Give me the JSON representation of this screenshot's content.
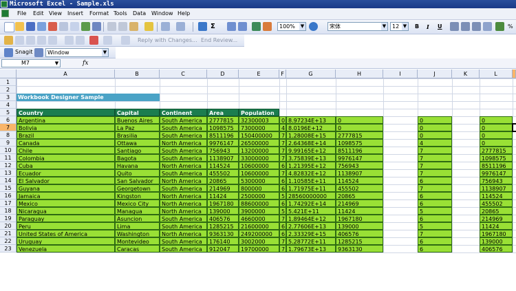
{
  "window": {
    "title": "Microsoft Excel - Sample.xls"
  },
  "menu": [
    "File",
    "Edit",
    "View",
    "Insert",
    "Format",
    "Tools",
    "Data",
    "Window",
    "Help"
  ],
  "toolbar": {
    "zoom": "100%",
    "font": "宋体",
    "font_size": "12",
    "bold": "B",
    "italic": "I",
    "underline": "U",
    "percent": "%"
  },
  "toolbar2": {
    "reply_label": "Reply with Changes...",
    "end_review": "End Review..."
  },
  "toolbar3": {
    "snagit": "Snagit",
    "window_combo": "Window"
  },
  "formula": {
    "name_box": "M7",
    "fx": "fx"
  },
  "columns": [
    "A",
    "B",
    "C",
    "D",
    "E",
    "F",
    "G",
    "H",
    "I",
    "J",
    "K",
    "L"
  ],
  "rows": [
    "1",
    "2",
    "3",
    "4",
    "5",
    "6",
    "7",
    "8",
    "9",
    "10",
    "11",
    "12",
    "13",
    "14",
    "15",
    "16",
    "17",
    "18",
    "19",
    "20",
    "21",
    "22",
    "23"
  ],
  "sheet": {
    "title": "Workbook Designer Sample",
    "headers": [
      "Country",
      "Capital",
      "Continent",
      "Area",
      "Population"
    ],
    "data": [
      [
        "Argentina",
        "Buenos Aires",
        "South America",
        "2777815",
        "32300003",
        "0",
        "8.97234E+13",
        "0",
        "",
        "0",
        "",
        "0"
      ],
      [
        "Bolivia",
        "La Paz",
        "South America",
        "1098575",
        "7300000",
        "4",
        "8.0196E+12",
        "0",
        "",
        "0",
        "",
        "0"
      ],
      [
        "Brazil",
        "Brasilia",
        "South America",
        "8511196",
        "150400000",
        "7",
        "1.28008E+15",
        "2777815",
        "",
        "0",
        "",
        "0"
      ],
      [
        "Canada",
        "Ottawa",
        "North America",
        "9976147",
        "26500000",
        "7",
        "2.64368E+14",
        "1098575",
        "",
        "4",
        "",
        "0"
      ],
      [
        "Chile",
        "Santiago",
        "South America",
        "756943",
        "13200000",
        "7",
        "9.99165E+12",
        "8511196",
        "",
        "7",
        "",
        "2777815"
      ],
      [
        "Colombia",
        "Bagota",
        "South America",
        "1138907",
        "33000000",
        "7",
        "3.75839E+13",
        "9976147",
        "",
        "7",
        "",
        "1098575"
      ],
      [
        "Cuba",
        "Havana",
        "North America",
        "114524",
        "10600000",
        "6",
        "1.21395E+12",
        "756943",
        "",
        "7",
        "",
        "8511196"
      ],
      [
        "Ecuador",
        "Quito",
        "South America",
        "455502",
        "10600000",
        "7",
        "4.82832E+12",
        "1138907",
        "",
        "7",
        "",
        "9976147"
      ],
      [
        "El Salvador",
        "San Salvador",
        "North America",
        "20865",
        "5300000",
        "6",
        "1.10585E+11",
        "114524",
        "",
        "6",
        "",
        "756943"
      ],
      [
        "Guyana",
        "Georgetown",
        "South America",
        "214969",
        "800000",
        "6",
        "1.71975E+11",
        "455502",
        "",
        "7",
        "",
        "1138907"
      ],
      [
        "Jamaica",
        "Kingston",
        "North America",
        "11424",
        "2500000",
        "5",
        "28560000000",
        "20865",
        "",
        "6",
        "",
        "114524"
      ],
      [
        "Mexico",
        "Mexico City",
        "North America",
        "1967180",
        "88600000",
        "6",
        "1.74292E+14",
        "214969",
        "",
        "6",
        "",
        "455502"
      ],
      [
        "Nicaragua",
        "Managua",
        "North America",
        "139000",
        "3900000",
        "5",
        "5.421E+11",
        "11424",
        "",
        "5",
        "",
        "20865"
      ],
      [
        "Paraguay",
        "Asuncion",
        "South America",
        "406576",
        "4660000",
        "7",
        "1.89464E+12",
        "1967180",
        "",
        "6",
        "",
        "214969"
      ],
      [
        "Peru",
        "Lima",
        "South America",
        "1285215",
        "21600000",
        "6",
        "2.77606E+13",
        "139000",
        "",
        "5",
        "",
        "11424"
      ],
      [
        "United States of America",
        "Washington",
        "North America",
        "9363130",
        "249200000",
        "6",
        "2.33329E+15",
        "406576",
        "",
        "7",
        "",
        "1967180"
      ],
      [
        "Uruguay",
        "Montevideo",
        "South America",
        "176140",
        "3002000",
        "7",
        "5.28772E+11",
        "1285215",
        "",
        "6",
        "",
        "139000"
      ],
      [
        "Venezuela",
        "Caracas",
        "South America",
        "912047",
        "19700000",
        "7",
        "1.79673E+13",
        "9363130",
        "",
        "6",
        "",
        "406576"
      ]
    ]
  },
  "colors": {
    "header_fill": "#1b7d4f",
    "data_fill": "#99e035",
    "title_fill": "#4aa3c6",
    "selection_header": "#f9b56a"
  }
}
